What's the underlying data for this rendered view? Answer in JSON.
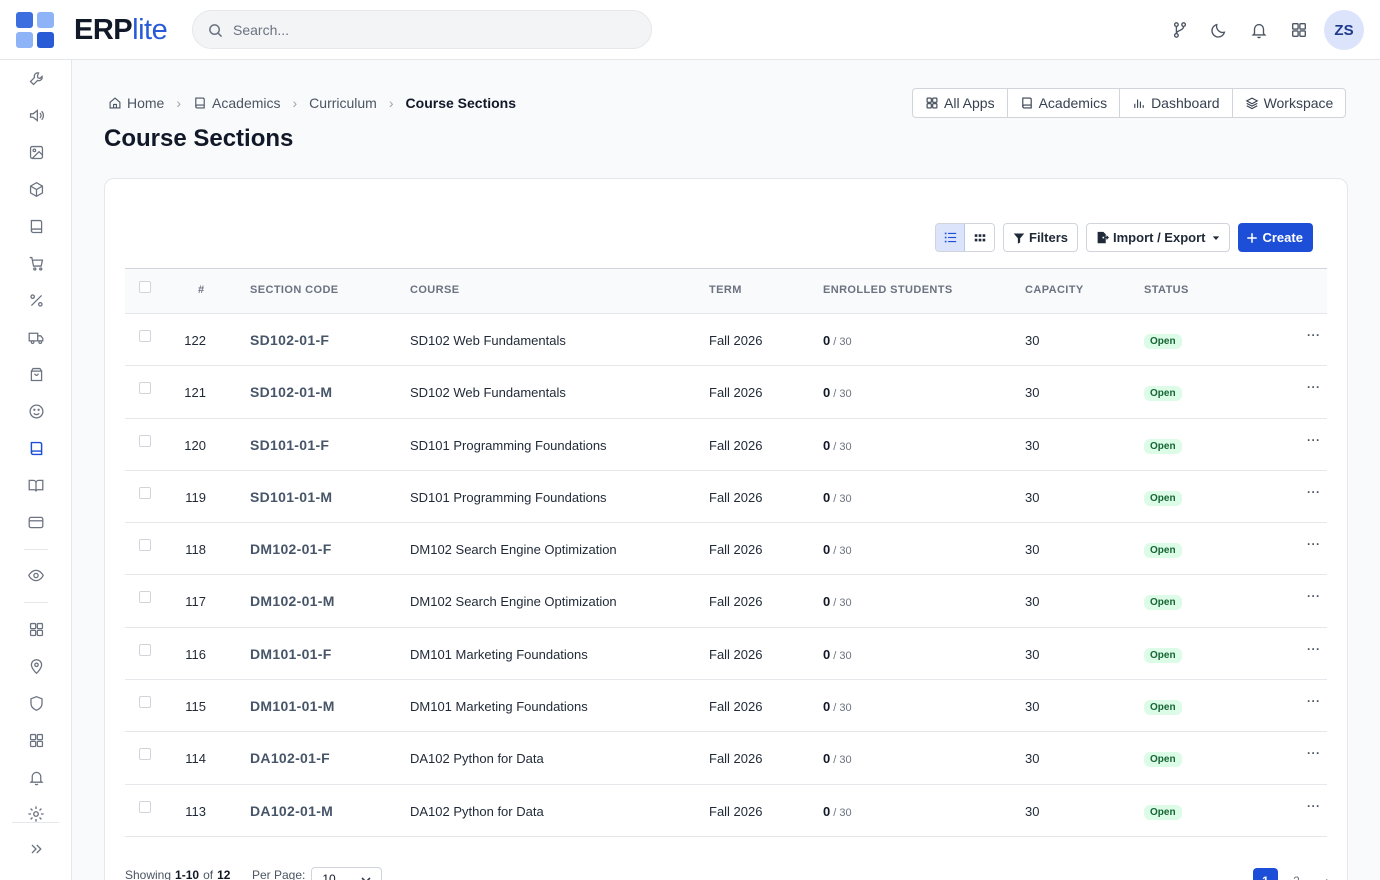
{
  "brand": {
    "name_bold": "ERP",
    "name_light": "lite",
    "colors": [
      "#5b8def",
      "#8eb3f7",
      "#2a5bd7",
      "#3d6ee0"
    ]
  },
  "search": {
    "placeholder": "Search..."
  },
  "topbar": {
    "avatar_initials": "ZS",
    "icons": [
      "git-branch-icon",
      "moon-icon",
      "bell-icon",
      "grid-icon"
    ]
  },
  "sidebar": {
    "icons": [
      "wrench-icon",
      "megaphone-icon",
      "image-icon",
      "box-icon",
      "book-icon",
      "cart-icon",
      "percent-icon",
      "truck-icon",
      "bag-icon",
      "smile-icon",
      "book-active-icon",
      "book-open-icon",
      "credit-card-icon",
      "eye-icon",
      "apps-icon",
      "location-pin-icon",
      "shield-icon",
      "apps-2-icon",
      "bell-icon",
      "gear-icon",
      "chevrons-right-icon"
    ],
    "active": "book-active-icon"
  },
  "breadcrumb": [
    {
      "label": "Home",
      "icon": "home-icon"
    },
    {
      "label": "Academics",
      "icon": "book-icon"
    },
    {
      "label": "Curriculum",
      "icon": ""
    },
    {
      "label": "Course Sections",
      "icon": ""
    }
  ],
  "page": {
    "title": "Course Sections"
  },
  "app_switch": [
    {
      "label": "All Apps",
      "icon": "grid-icon"
    },
    {
      "label": "Academics",
      "icon": "book-icon"
    },
    {
      "label": "Dashboard",
      "icon": "bar-chart-icon"
    },
    {
      "label": "Workspace",
      "icon": "layers-icon"
    }
  ],
  "toolbar": {
    "filters_label": "Filters",
    "import_export_label": "Import / Export",
    "create_label": "Create",
    "accent": "#1d4ed8"
  },
  "table": {
    "columns": [
      "#",
      "SECTION CODE",
      "COURSE",
      "TERM",
      "ENROLLED STUDENTS",
      "CAPACITY",
      "STATUS"
    ],
    "rows": [
      {
        "id": "122",
        "code": "SD102-01-F",
        "course": "SD102 Web Fundamentals",
        "term": "Fall 2026",
        "enrolled": "0",
        "cap_suffix": " / 30",
        "capacity": "30",
        "status": "Open"
      },
      {
        "id": "121",
        "code": "SD102-01-M",
        "course": "SD102 Web Fundamentals",
        "term": "Fall 2026",
        "enrolled": "0",
        "cap_suffix": " / 30",
        "capacity": "30",
        "status": "Open"
      },
      {
        "id": "120",
        "code": "SD101-01-F",
        "course": "SD101 Programming Foundations",
        "term": "Fall 2026",
        "enrolled": "0",
        "cap_suffix": " / 30",
        "capacity": "30",
        "status": "Open"
      },
      {
        "id": "119",
        "code": "SD101-01-M",
        "course": "SD101 Programming Foundations",
        "term": "Fall 2026",
        "enrolled": "0",
        "cap_suffix": " / 30",
        "capacity": "30",
        "status": "Open"
      },
      {
        "id": "118",
        "code": "DM102-01-F",
        "course": "DM102 Search Engine Optimization",
        "term": "Fall 2026",
        "enrolled": "0",
        "cap_suffix": " / 30",
        "capacity": "30",
        "status": "Open"
      },
      {
        "id": "117",
        "code": "DM102-01-M",
        "course": "DM102 Search Engine Optimization",
        "term": "Fall 2026",
        "enrolled": "0",
        "cap_suffix": " / 30",
        "capacity": "30",
        "status": "Open"
      },
      {
        "id": "116",
        "code": "DM101-01-F",
        "course": "DM101 Marketing Foundations",
        "term": "Fall 2026",
        "enrolled": "0",
        "cap_suffix": " / 30",
        "capacity": "30",
        "status": "Open"
      },
      {
        "id": "115",
        "code": "DM101-01-M",
        "course": "DM101 Marketing Foundations",
        "term": "Fall 2026",
        "enrolled": "0",
        "cap_suffix": " / 30",
        "capacity": "30",
        "status": "Open"
      },
      {
        "id": "114",
        "code": "DA102-01-F",
        "course": "DA102 Python for Data",
        "term": "Fall 2026",
        "enrolled": "0",
        "cap_suffix": " / 30",
        "capacity": "30",
        "status": "Open"
      },
      {
        "id": "113",
        "code": "DA102-01-M",
        "course": "DA102 Python for Data",
        "term": "Fall 2026",
        "enrolled": "0",
        "cap_suffix": " / 30",
        "capacity": "30",
        "status": "Open"
      }
    ]
  },
  "footer": {
    "showing_prefix": "Showing",
    "showing_range": "1-10",
    "showing_of": "of",
    "total": "12",
    "per_page_label": "Per Page:",
    "per_page_value": "10",
    "pages": [
      "1",
      "2",
      "›"
    ],
    "current_page": "1"
  }
}
